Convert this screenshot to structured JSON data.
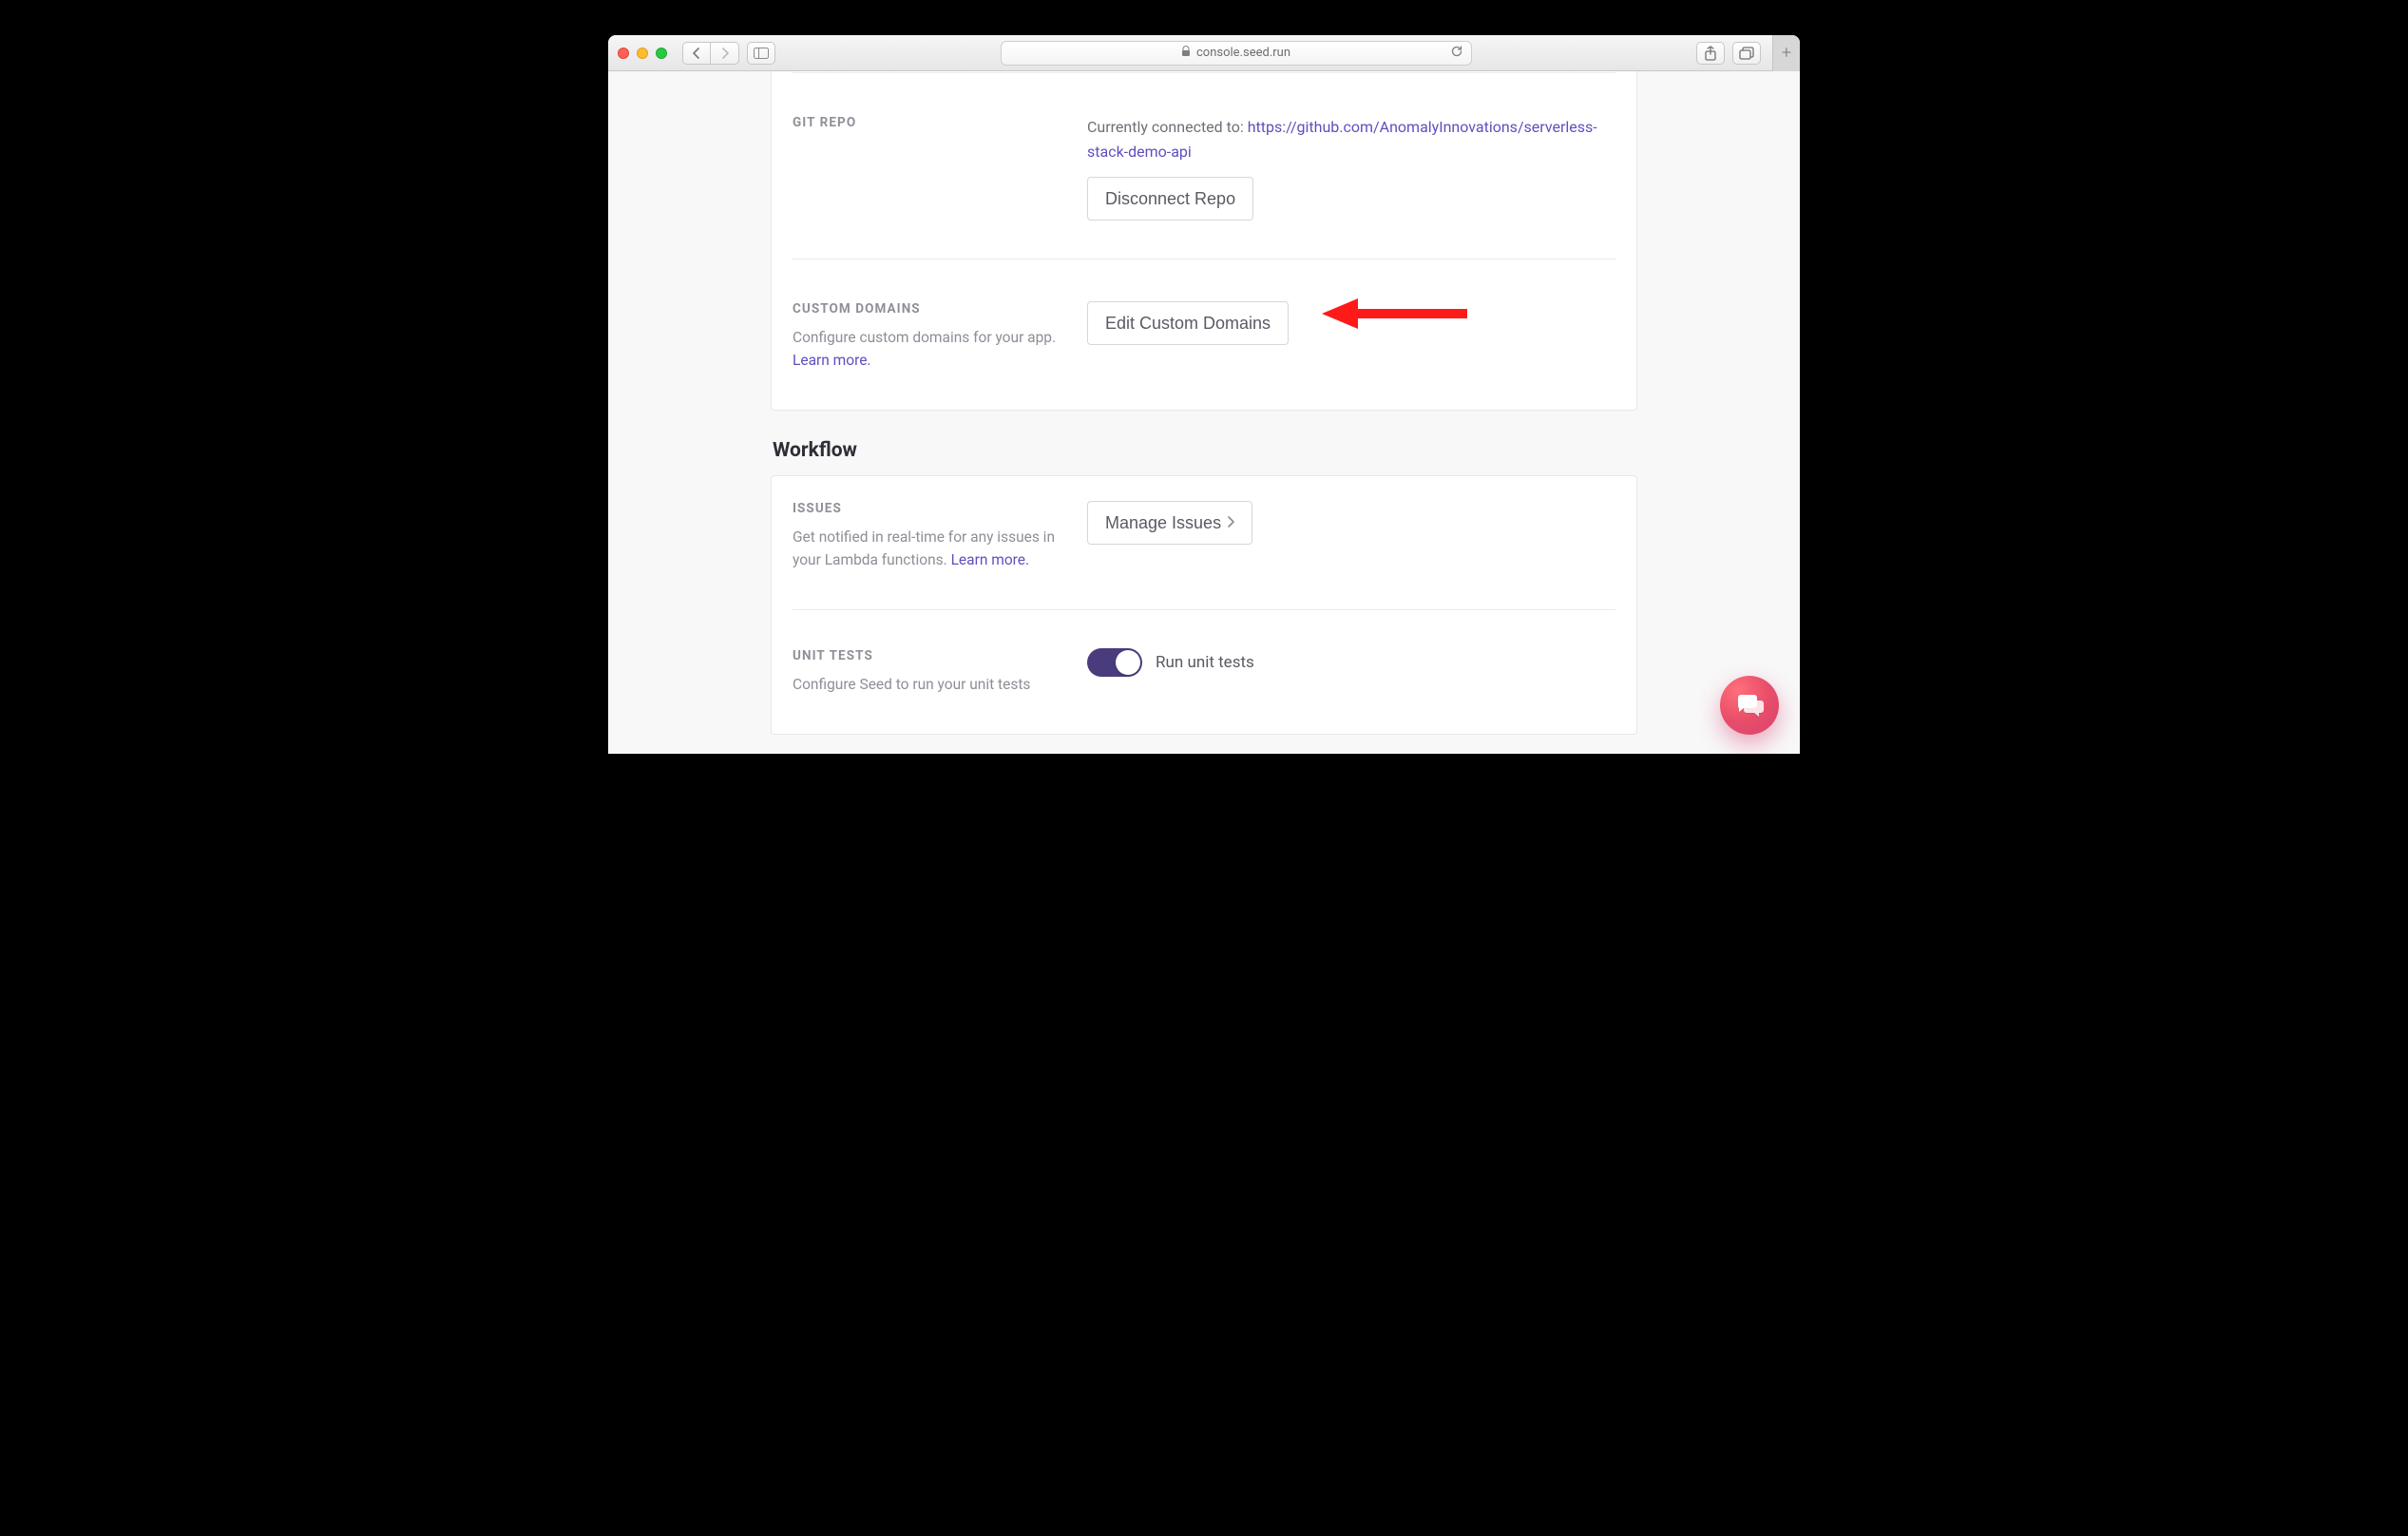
{
  "browser": {
    "url_display": "console.seed.run"
  },
  "gitRepo": {
    "title": "GIT REPO",
    "connected_prefix": "Currently connected to: ",
    "repo_url": "https://github.com/AnomalyInnovations/serverless-stack-demo-api",
    "disconnect_label": "Disconnect Repo"
  },
  "customDomains": {
    "title": "CUSTOM DOMAINS",
    "desc_prefix": "Configure custom domains for your app. ",
    "learn_more": "Learn more.",
    "edit_label": "Edit Custom Domains"
  },
  "workflow": {
    "heading": "Workflow"
  },
  "issues": {
    "title": "ISSUES",
    "desc_prefix": "Get notified in real-time for any issues in your Lambda functions. ",
    "learn_more": "Learn more.",
    "manage_label": "Manage Issues"
  },
  "unitTests": {
    "title": "UNIT TESTS",
    "desc": "Configure Seed to run your unit tests",
    "toggle_label": "Run unit tests",
    "enabled": true
  }
}
